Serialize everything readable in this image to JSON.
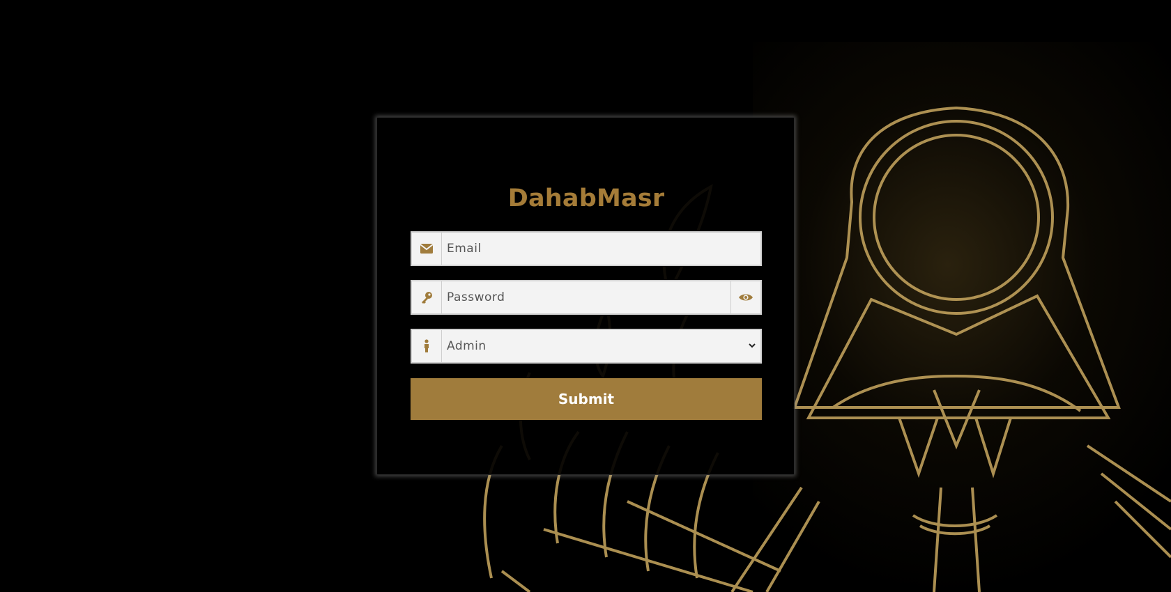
{
  "brand": {
    "name": "DahabMasr"
  },
  "form": {
    "email": {
      "placeholder": "Email",
      "value": ""
    },
    "password": {
      "placeholder": "Password",
      "value": ""
    },
    "role": {
      "selected": "Admin"
    },
    "submit_label": "Submit"
  },
  "colors": {
    "accent": "#a07c3c",
    "brand_text": "#a57c38",
    "background": "#000000",
    "field_bg": "#f3f3f3"
  },
  "icons": {
    "email": "envelope-icon",
    "password": "key-icon",
    "toggle_password": "eye-icon",
    "role": "person-icon"
  }
}
